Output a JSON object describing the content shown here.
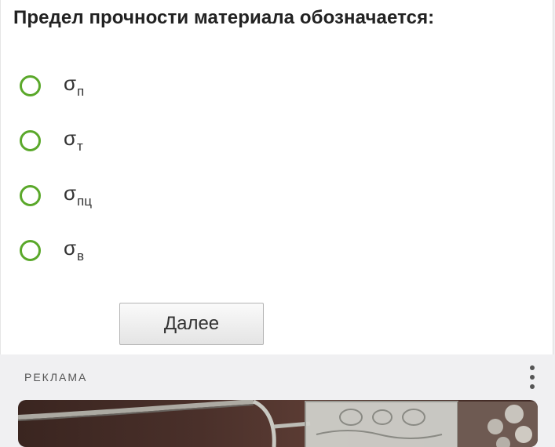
{
  "question": {
    "text": "Предел прочности материала обозначается:"
  },
  "options": [
    {
      "symbol": "σ",
      "subscript": "п"
    },
    {
      "symbol": "σ",
      "subscript": "т"
    },
    {
      "symbol": "σ",
      "subscript": "пц"
    },
    {
      "symbol": "σ",
      "subscript": "в"
    }
  ],
  "next_button": {
    "label": "Далее"
  },
  "ad": {
    "label": "РЕКЛАМА",
    "menu_icon": "kebab-menu-icon"
  },
  "colors": {
    "radio_accent": "#5aa82a",
    "ad_background": "#f0f0f2"
  }
}
